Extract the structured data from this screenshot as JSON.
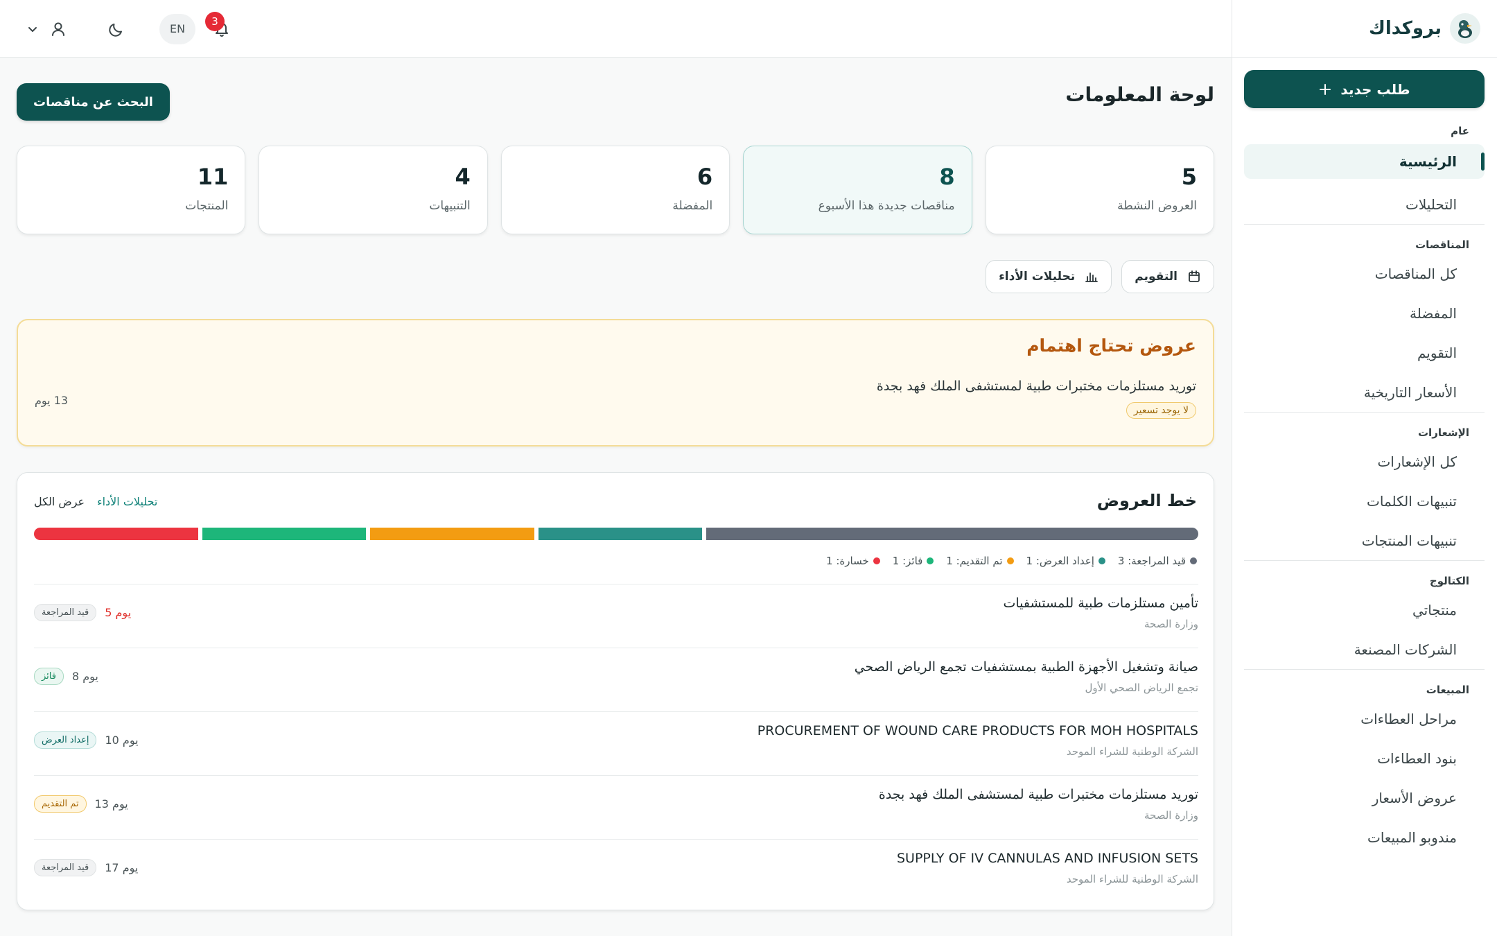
{
  "brand": {
    "name": "بروكداك"
  },
  "sidebar": {
    "new_request_label": "طلب جديد",
    "groups": [
      {
        "title": "عام",
        "items": [
          {
            "label": "الرئيسية",
            "active": true
          },
          {
            "label": "التحليلات"
          }
        ]
      },
      {
        "title": "المناقصات",
        "items": [
          {
            "label": "كل المناقصات"
          },
          {
            "label": "المفضلة"
          },
          {
            "label": "التقويم"
          },
          {
            "label": "الأسعار التاريخية"
          }
        ]
      },
      {
        "title": "الإشعارات",
        "items": [
          {
            "label": "كل الإشعارات"
          },
          {
            "label": "تنبيهات الكلمات"
          },
          {
            "label": "تنبيهات المنتجات"
          }
        ]
      },
      {
        "title": "الكتالوج",
        "items": [
          {
            "label": "منتجاتي"
          },
          {
            "label": "الشركات المصنعة"
          }
        ]
      },
      {
        "title": "المبيعات",
        "items": [
          {
            "label": "مراحل العطاءات"
          },
          {
            "label": "بنود العطاءات"
          },
          {
            "label": "عروض الأسعار"
          },
          {
            "label": "مندوبو المبيعات"
          }
        ]
      }
    ]
  },
  "topbar": {
    "lang_label": "EN",
    "notification_count": "3"
  },
  "page": {
    "title": "لوحة المعلومات",
    "search_button_label": "البحث عن مناقصات"
  },
  "stats": [
    {
      "value": "5",
      "label": "العروض النشطة"
    },
    {
      "value": "8",
      "label": "مناقصات جديدة هذا الأسبوع",
      "highlight": true
    },
    {
      "value": "6",
      "label": "المفضلة"
    },
    {
      "value": "4",
      "label": "التنبيهات"
    },
    {
      "value": "11",
      "label": "المنتجات"
    }
  ],
  "quick_actions": {
    "calendar_label": "التقويم",
    "analytics_label": "تحليلات الأداء"
  },
  "attention": {
    "title": "عروض تحتاج اهتمام",
    "item_title": "توريد مستلزمات مختبرات طبية لمستشفى الملك فهد بجدة",
    "item_tag": "لا يوجد تسعير",
    "item_days": "13 يوم"
  },
  "pipeline": {
    "title": "خط العروض",
    "link_analytics": "تحليلات الأداء",
    "link_all": "عرض الكل",
    "segments": [
      {
        "label": "قيد المراجعة: 3",
        "count": 3,
        "color": "#636b78"
      },
      {
        "label": "إعداد العرض: 1",
        "count": 1,
        "color": "#2a9188"
      },
      {
        "label": "تم التقديم: 1",
        "count": 1,
        "color": "#f39c12"
      },
      {
        "label": "فائز: 1",
        "count": 1,
        "color": "#1db67a"
      },
      {
        "label": "خسارة: 1",
        "count": 1,
        "color": "#ec3440"
      }
    ],
    "rows": [
      {
        "title": "تأمين مستلزمات طبية للمستشفيات",
        "subtitle": "وزارة الصحة",
        "days": "5 يوم",
        "urgent": true,
        "status": "قيد المراجعة",
        "status_type": "review"
      },
      {
        "title": "صيانة وتشغيل الأجهزة الطبية بمستشفيات تجمع الرياض الصحي",
        "subtitle": "تجمع الرياض الصحي الأول",
        "days": "8 يوم",
        "status": "فائز",
        "status_type": "won"
      },
      {
        "title": "PROCUREMENT OF WOUND CARE PRODUCTS FOR MOH HOSPITALS",
        "subtitle": "الشركة الوطنية للشراء الموحد",
        "days": "10 يوم",
        "status": "إعداد العرض",
        "status_type": "prep"
      },
      {
        "title": "توريد مستلزمات مختبرات طبية لمستشفى الملك فهد بجدة",
        "subtitle": "وزارة الصحة",
        "days": "13 يوم",
        "status": "تم التقديم",
        "status_type": "submitted"
      },
      {
        "title": "SUPPLY OF IV CANNULAS AND INFUSION SETS",
        "subtitle": "الشركة الوطنية للشراء الموحد",
        "days": "17 يوم",
        "status": "قيد المراجعة",
        "status_type": "review"
      }
    ]
  },
  "icons": {
    "logo": "duck-logo-icon",
    "plus": "plus-icon",
    "bell": "bell-icon",
    "moon": "moon-icon",
    "user": "user-icon",
    "chevron": "chevron-down-icon",
    "calendar": "calendar-icon",
    "chart": "bar-chart-icon"
  }
}
